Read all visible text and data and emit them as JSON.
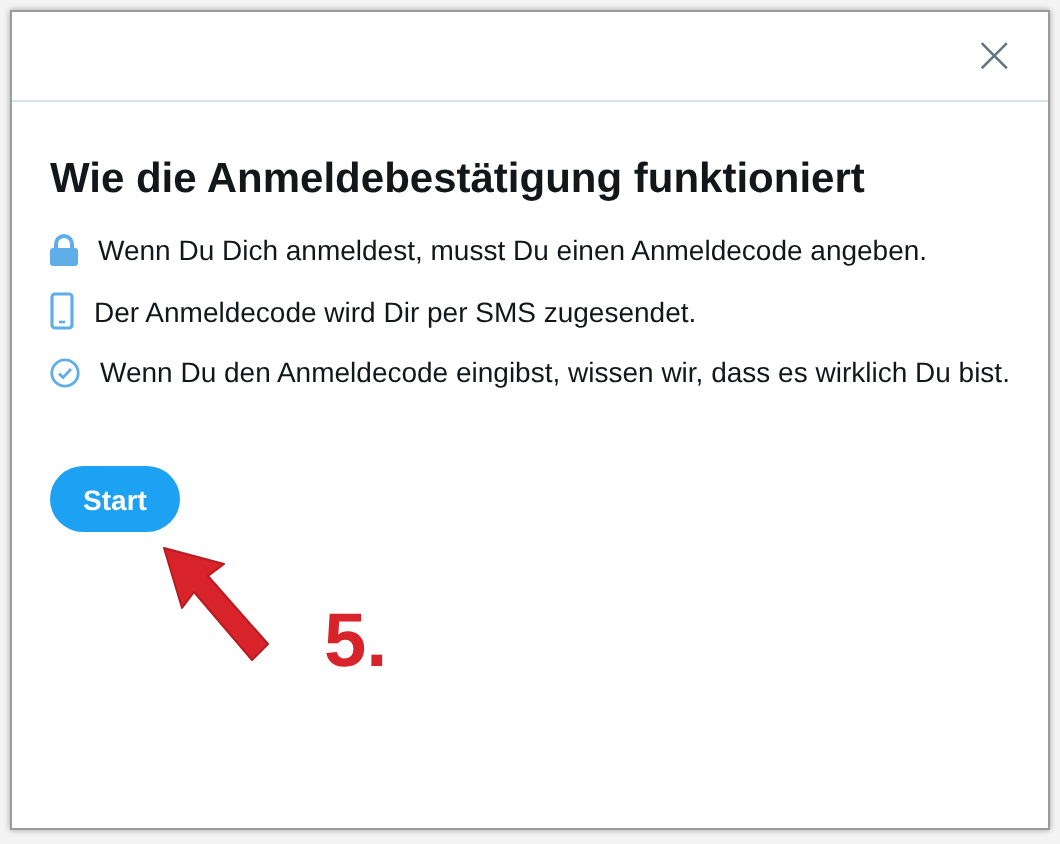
{
  "dialog": {
    "close": "×",
    "title": "Wie die Anmeldebestätigung funktioniert",
    "items": [
      {
        "kind": "lock",
        "text": "Wenn Du Dich anmeldest, musst Du einen Anmeldecode angeben."
      },
      {
        "kind": "phone",
        "text": "Der Anmeldecode wird Dir per SMS zugesendet."
      },
      {
        "kind": "check",
        "text": "Wenn Du den Anmeldecode eingibst, wissen wir, dass es wirklich Du bist."
      }
    ],
    "button": "Start"
  },
  "annotation": {
    "label": "5."
  }
}
